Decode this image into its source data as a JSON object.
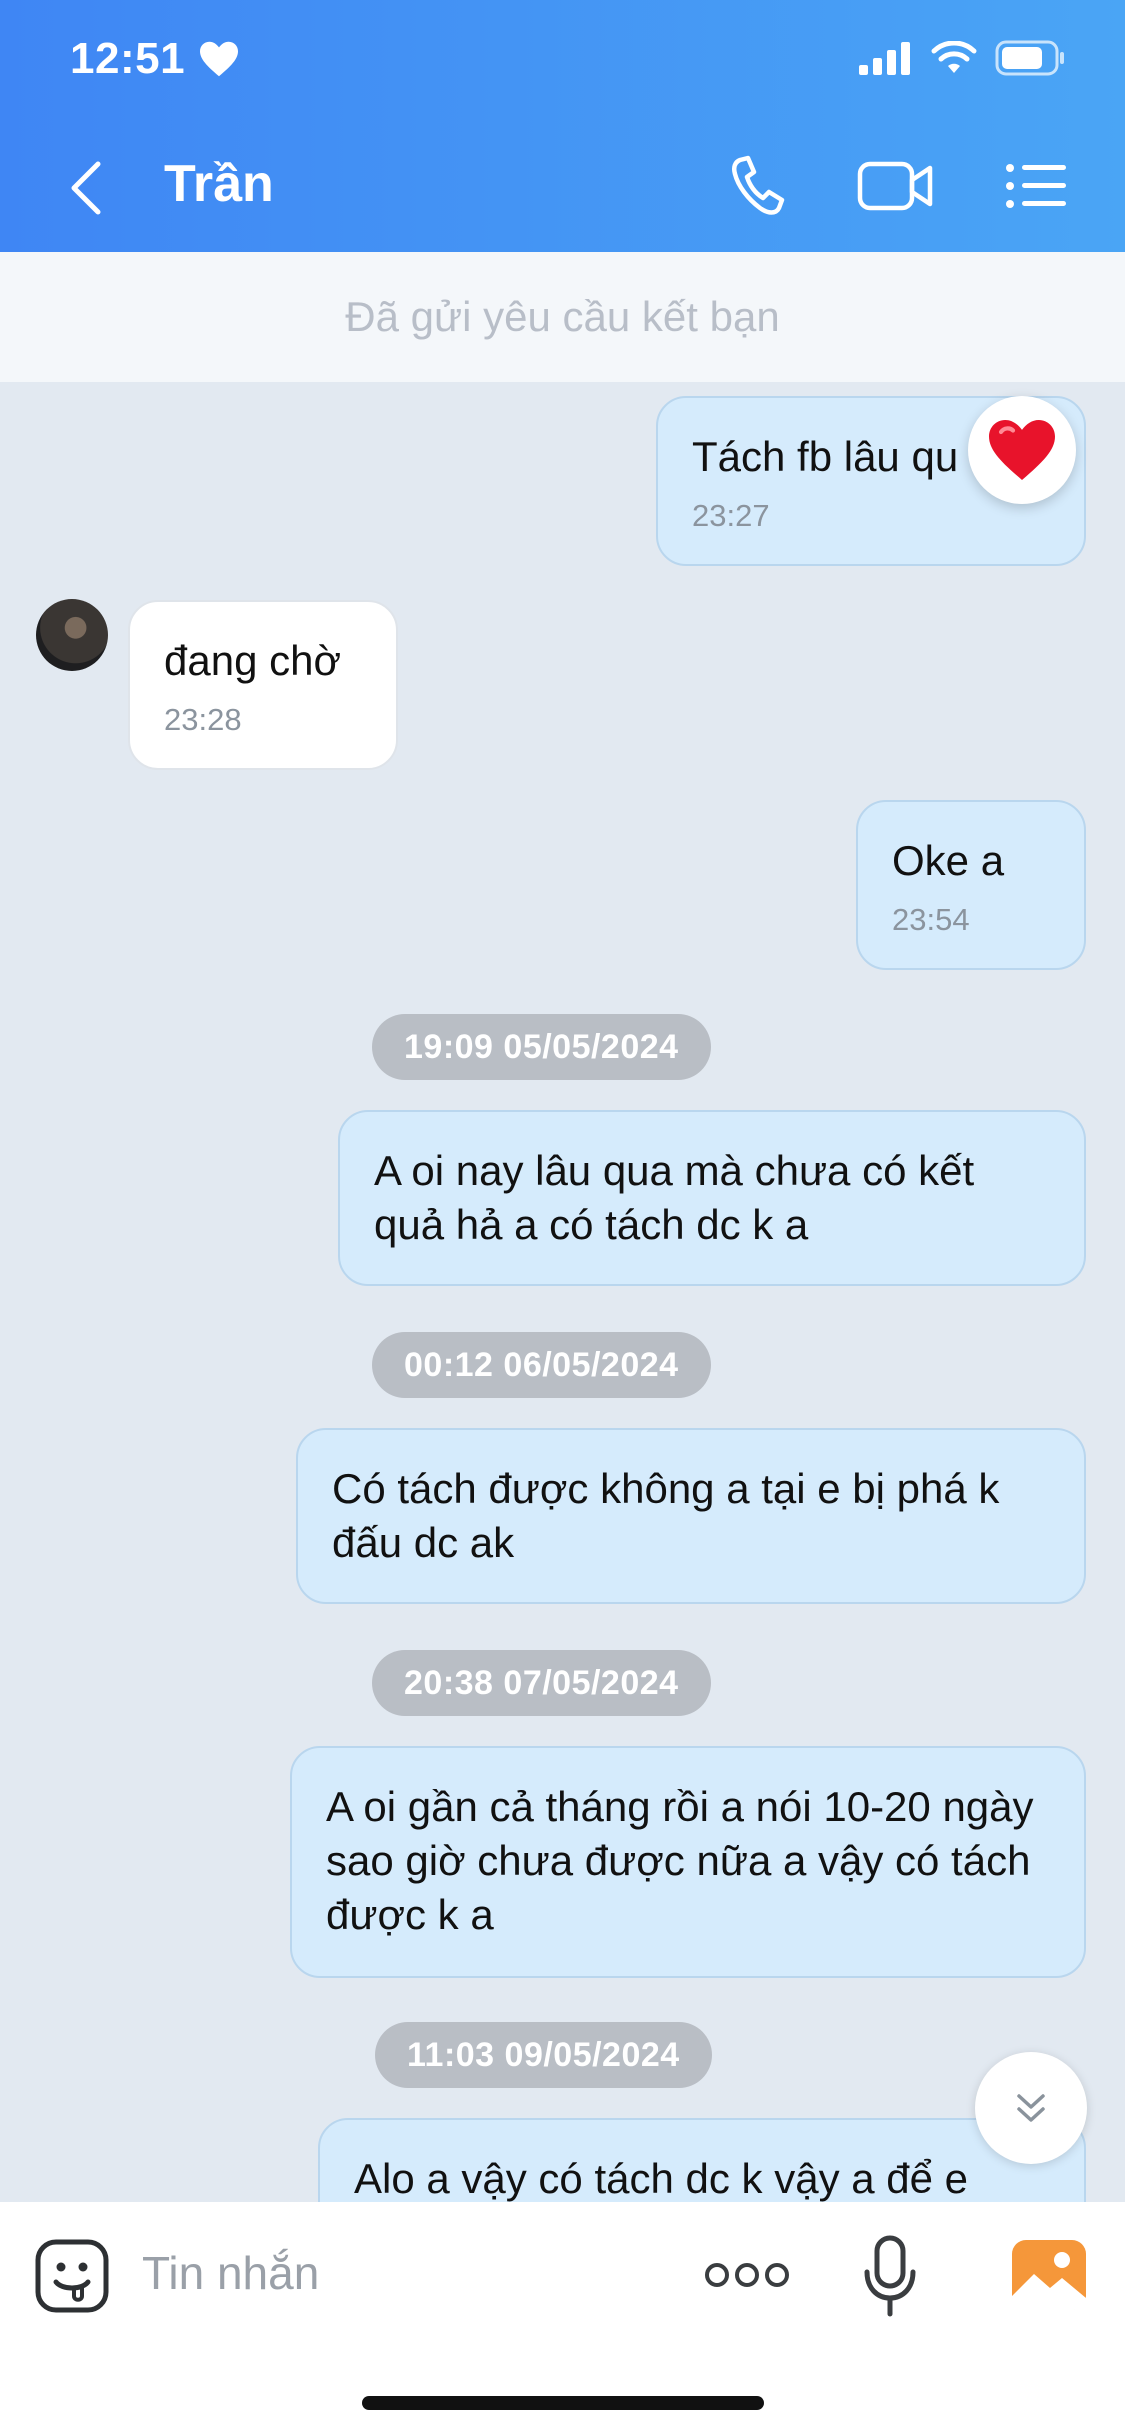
{
  "status_bar": {
    "time": "12:51"
  },
  "header": {
    "title": "Trần"
  },
  "banner": {
    "text": "Đã gửi yêu cầu kết bạn"
  },
  "messages": [
    {
      "text": "Tách fb lâu qu",
      "time": "23:27"
    },
    {
      "text": "đang chờ",
      "time": "23:28"
    },
    {
      "text": "Oke a",
      "time": "23:54"
    },
    {
      "date": "19:09 05/05/2024",
      "text": "A oi nay lâu qua mà chưa có kết quả hả a có tách dc k a"
    },
    {
      "date": "00:12 06/05/2024",
      "text": "Có tách được không a tại e bị phá k đấu dc ak"
    },
    {
      "date": "20:38 07/05/2024",
      "text": "A oi gần cả tháng rồi a nói 10-20 ngày sao giờ chưa được nữa a vậy có tách được k a"
    },
    {
      "date": "11:03 09/05/2024",
      "text": "Alo a vậy có tách dc k vậy a để e"
    }
  ],
  "input": {
    "placeholder": "Tin nhắn"
  },
  "colors": {
    "header_start": "#3f86f4",
    "header_end": "#4aa5f5",
    "outgoing_bubble": "#d5ebfc",
    "chat_background": "#e2e9f1"
  }
}
